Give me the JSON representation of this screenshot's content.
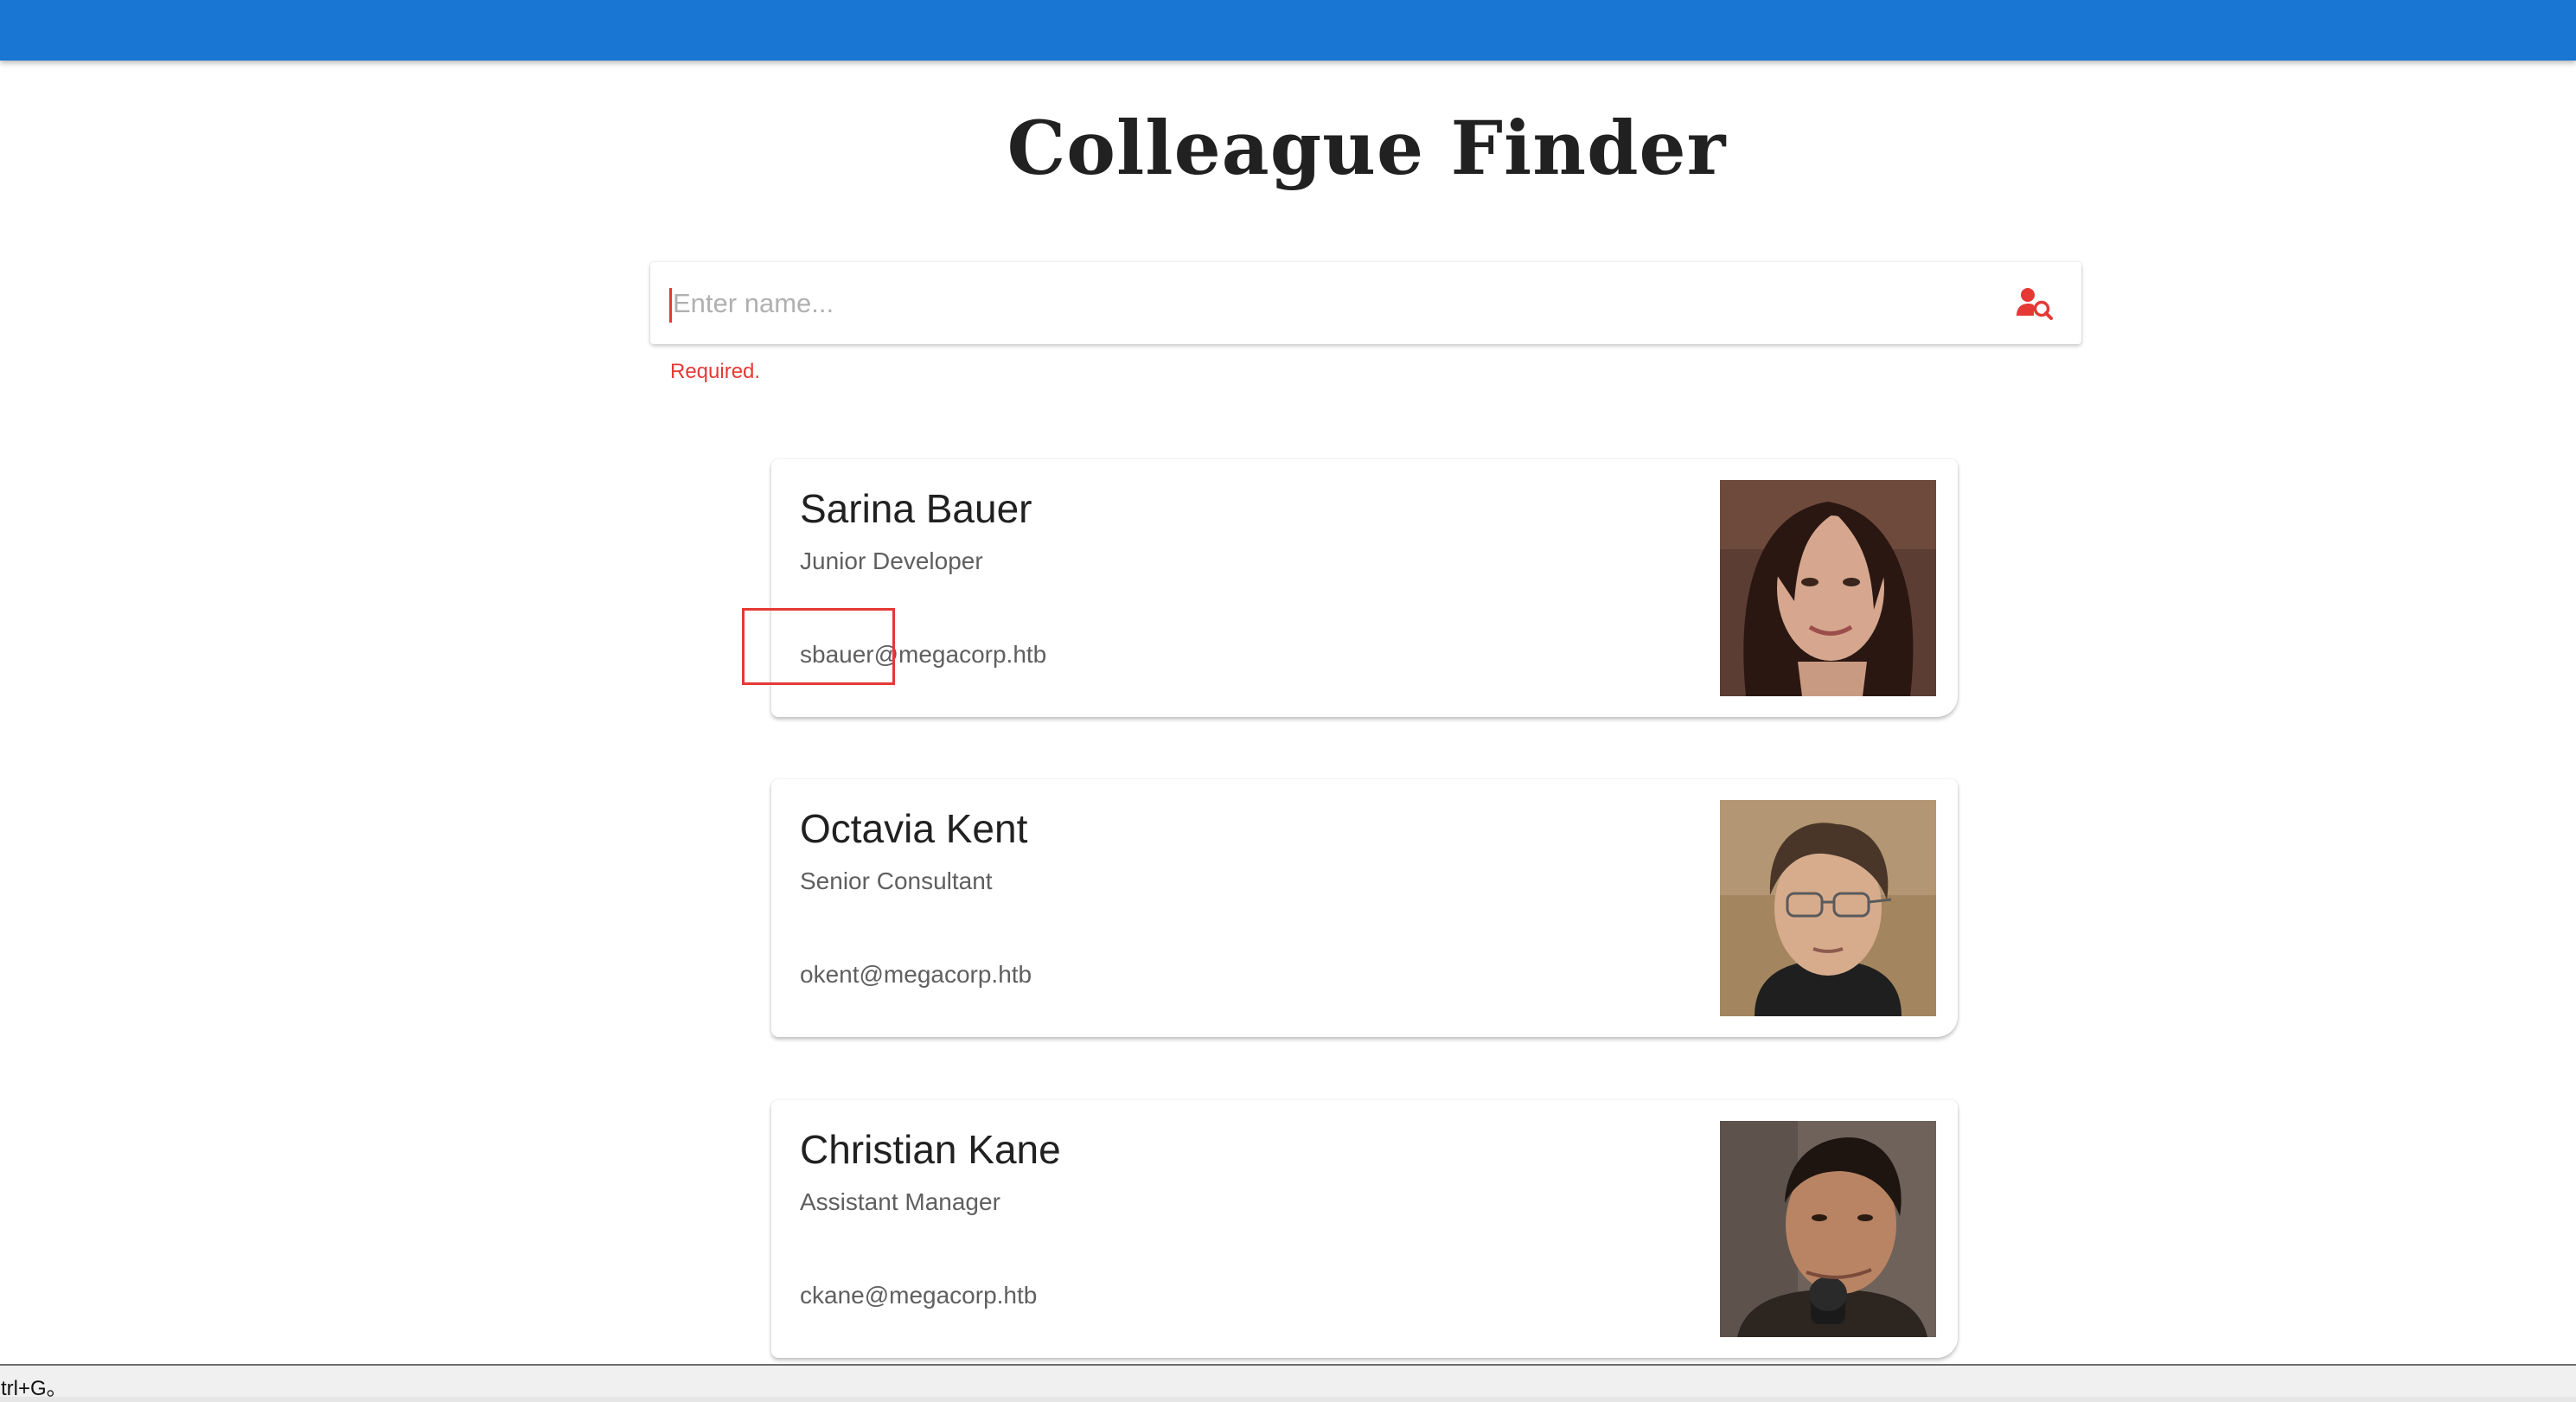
{
  "header": {
    "bar_color": "#1976d2"
  },
  "page": {
    "title": "Colleague Finder"
  },
  "search": {
    "placeholder": "Enter name...",
    "value": "",
    "icon": "person-search-icon",
    "accent_color": "#e53935",
    "validation_message": "Required."
  },
  "colleagues": [
    {
      "name": "Sarina Bauer",
      "role": "Junior Developer",
      "email": "sbauer@megacorp.htb",
      "photo": "woman-portrait"
    },
    {
      "name": "Octavia Kent",
      "role": "Senior Consultant",
      "email": "okent@megacorp.htb",
      "photo": "man-with-glasses-portrait"
    },
    {
      "name": "Christian Kane",
      "role": "Assistant Manager",
      "email": "ckane@megacorp.htb",
      "photo": "man-with-microphone-portrait"
    }
  ],
  "status_bar": {
    "text": "trl+G。"
  }
}
